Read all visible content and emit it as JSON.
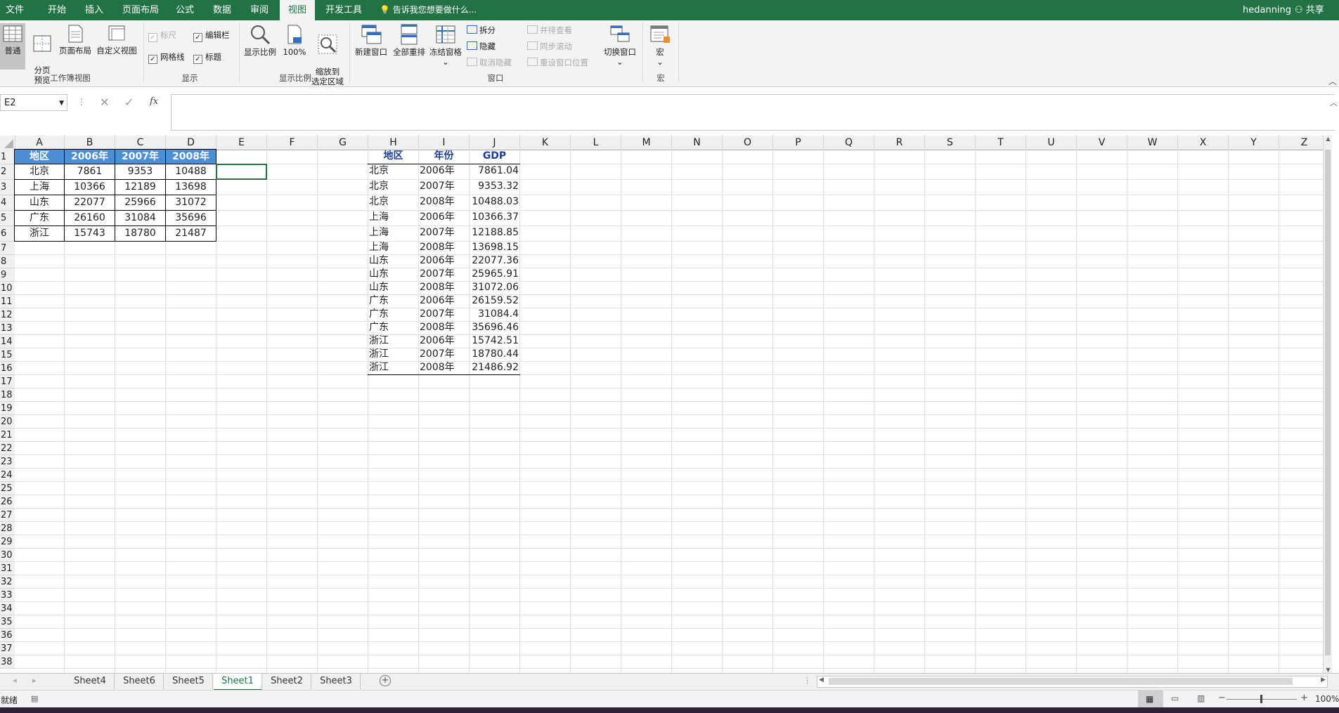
{
  "menu": {
    "tabs": [
      "文件",
      "开始",
      "插入",
      "页面布局",
      "公式",
      "数据",
      "审阅",
      "视图",
      "开发工具"
    ],
    "active_tab": "视图",
    "tell_me": "告诉我您想要做什么...",
    "user": "hedanning",
    "share": "共享"
  },
  "ribbon": {
    "workbook_views": {
      "normal": "普通",
      "page_break": "分页\n预览",
      "page_layout": "页面布局",
      "custom_views": "自定义视图",
      "group": "工作簿视图"
    },
    "show": {
      "ruler": "标尺",
      "formula_bar": "编辑栏",
      "gridlines": "网格线",
      "headings": "标题",
      "group": "显示"
    },
    "zoom": {
      "zoom": "显示比例",
      "hundred": "100%",
      "zoom_selection": "缩放到\n选定区域",
      "group": "显示比例"
    },
    "window": {
      "new_window": "新建窗口",
      "arrange_all": "全部重排",
      "freeze_panes": "冻结窗格",
      "split": "拆分",
      "hide": "隐藏",
      "unhide": "取消隐藏",
      "side_by_side": "并排查看",
      "sync_scroll": "同步滚动",
      "reset_position": "重设窗口位置",
      "switch_windows": "切换窗口",
      "group": "窗口"
    },
    "macros": {
      "macros": "宏",
      "group": "宏"
    }
  },
  "formula_bar": {
    "name_box": "E2",
    "fx": "fx",
    "value": ""
  },
  "columns": [
    "A",
    "B",
    "C",
    "D",
    "E",
    "F",
    "G",
    "H",
    "I",
    "J",
    "K",
    "L",
    "M",
    "N",
    "O",
    "P",
    "Q",
    "R",
    "S",
    "T",
    "U",
    "V",
    "W",
    "X",
    "Y",
    "Z"
  ],
  "rows": [
    "1",
    "2",
    "3",
    "4",
    "5",
    "6",
    "7",
    "8",
    "9",
    "10",
    "11",
    "12",
    "13",
    "14",
    "15",
    "16",
    "17",
    "18",
    "19",
    "20",
    "21",
    "22",
    "23",
    "24",
    "25",
    "26",
    "27",
    "28",
    "29",
    "30",
    "31",
    "32",
    "33",
    "34",
    "35",
    "36",
    "37",
    "38"
  ],
  "table1": {
    "headers": [
      "地区",
      "2006年",
      "2007年",
      "2008年"
    ],
    "rows": [
      [
        "北京",
        "7861",
        "9353",
        "10488"
      ],
      [
        "上海",
        "10366",
        "12189",
        "13698"
      ],
      [
        "山东",
        "22077",
        "25966",
        "31072"
      ],
      [
        "广东",
        "26160",
        "31084",
        "35696"
      ],
      [
        "浙江",
        "15743",
        "18780",
        "21487"
      ]
    ]
  },
  "table2": {
    "headers": [
      "地区",
      "年份",
      "GDP"
    ],
    "rows": [
      [
        "北京",
        "2006年",
        "7861.04"
      ],
      [
        "北京",
        "2007年",
        "9353.32"
      ],
      [
        "北京",
        "2008年",
        "10488.03"
      ],
      [
        "上海",
        "2006年",
        "10366.37"
      ],
      [
        "上海",
        "2007年",
        "12188.85"
      ],
      [
        "上海",
        "2008年",
        "13698.15"
      ],
      [
        "山东",
        "2006年",
        "22077.36"
      ],
      [
        "山东",
        "2007年",
        "25965.91"
      ],
      [
        "山东",
        "2008年",
        "31072.06"
      ],
      [
        "广东",
        "2006年",
        "26159.52"
      ],
      [
        "广东",
        "2007年",
        "31084.4"
      ],
      [
        "广东",
        "2008年",
        "35696.46"
      ],
      [
        "浙江",
        "2006年",
        "15742.51"
      ],
      [
        "浙江",
        "2007年",
        "18780.44"
      ],
      [
        "浙江",
        "2008年",
        "21486.92"
      ]
    ]
  },
  "sheets": [
    "Sheet4",
    "Sheet6",
    "Sheet5",
    "Sheet1",
    "Sheet2",
    "Sheet3"
  ],
  "active_sheet": "Sheet1",
  "status": {
    "ready": "就绪",
    "zoom": "100%"
  },
  "colors": {
    "accent": "#217346",
    "header_fill": "#4d8fd6",
    "table2_header": "#1f3f8f"
  }
}
